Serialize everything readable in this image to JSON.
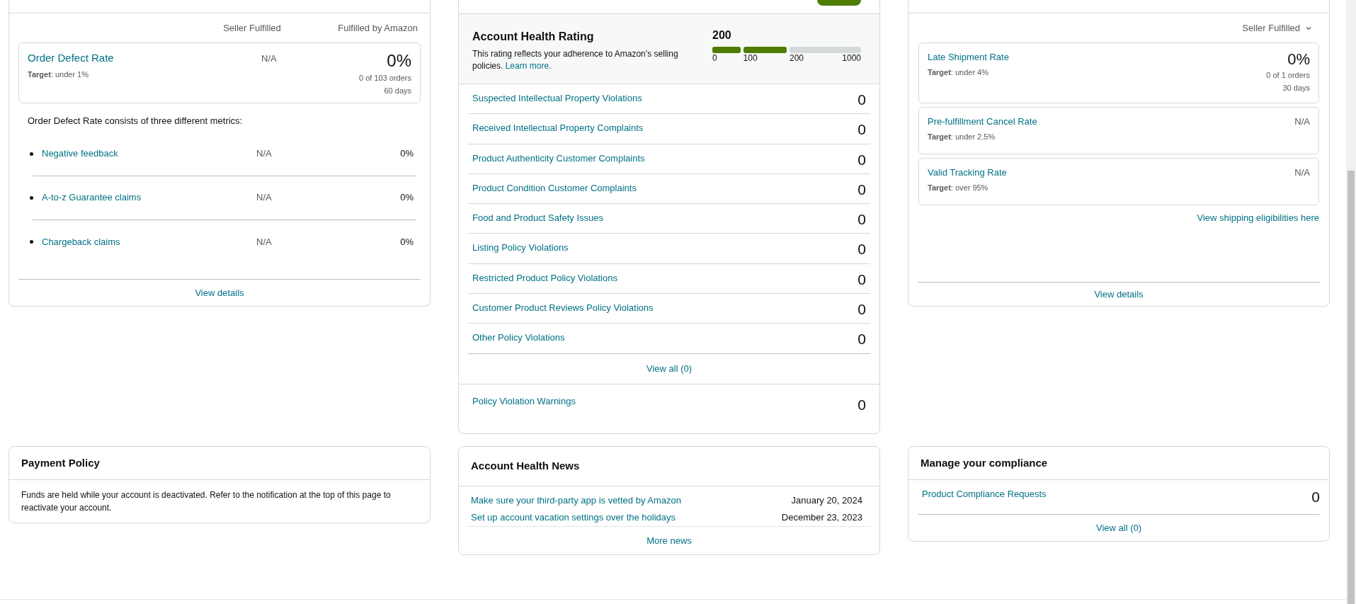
{
  "customer_service": {
    "columns": [
      "Seller Fulfilled",
      "Fulfilled by Amazon"
    ],
    "metric": {
      "name": "Order Defect Rate",
      "target": "**Target**: under 1%",
      "seller": "N/A",
      "fba": "0%",
      "orders": "0 of 103 orders",
      "period": "60 days"
    },
    "description": "Order Defect Rate consists of three different metrics:",
    "sub_metrics": [
      {
        "name": "Negative feedback",
        "seller": "N/A",
        "fba": "0%"
      },
      {
        "name": "A-to-z Guarantee claims",
        "seller": "N/A",
        "fba": "0%"
      },
      {
        "name": "Chargeback claims",
        "seller": "N/A",
        "fba": "0%"
      }
    ],
    "footer_link": "View details"
  },
  "policy_compliance": {
    "rating": {
      "title": "Account Health Rating",
      "description": "This rating reflects your adherence to Amazon’s selling policies.",
      "learn_more": "Learn more.",
      "score": "200",
      "segments": [
        {
          "filled": true
        },
        {
          "filled": true
        },
        {
          "filled": false
        }
      ],
      "ticks": [
        "0",
        "100",
        "200",
        "1000"
      ]
    },
    "violations": [
      {
        "label": "Suspected Intellectual Property Violations",
        "count": "0"
      },
      {
        "label": "Received Intellectual Property Complaints",
        "count": "0"
      },
      {
        "label": "Product Authenticity Customer Complaints",
        "count": "0"
      },
      {
        "label": "Product Condition Customer Complaints",
        "count": "0"
      },
      {
        "label": "Food and Product Safety Issues",
        "count": "0"
      },
      {
        "label": "Listing Policy Violations",
        "count": "0"
      },
      {
        "label": "Restricted Product Policy Violations",
        "count": "0"
      },
      {
        "label": "Customer Product Reviews Policy Violations",
        "count": "0"
      },
      {
        "label": "Other Policy Violations",
        "count": "0"
      }
    ],
    "view_all": "View all (0)",
    "warnings": {
      "label": "Policy Violation Warnings",
      "count": "0"
    }
  },
  "shipping": {
    "filter": "Seller Fulfilled",
    "metrics": [
      {
        "name": "Late Shipment Rate",
        "target": "**Target**: under 4%",
        "value": "0%",
        "orders": "0 of 1 orders",
        "period": "30 days"
      },
      {
        "name": "Pre-fulfillment Cancel Rate",
        "target": "**Target**: under 2.5%",
        "value": "N/A"
      },
      {
        "name": "Valid Tracking Rate",
        "target": "**Target**: over 95%",
        "value": "N/A"
      }
    ],
    "link": "View shipping eligibilities here",
    "footer_link": "View details"
  },
  "payment_policy": {
    "title": "Payment Policy",
    "text": "Funds are held while your account is deactivated. Refer to the notification at the top of this page to reactivate your account."
  },
  "news": {
    "title": "Account Health News",
    "items": [
      {
        "title": "Make sure your third-party app is vetted by Amazon",
        "date": "January 20, 2024"
      },
      {
        "title": "Set up account vacation settings over the holidays",
        "date": "December 23, 2023"
      }
    ],
    "more": "More news"
  },
  "compliance": {
    "title": "Manage your compliance",
    "items": [
      {
        "label": "Product Compliance Requests",
        "count": "0"
      }
    ],
    "view_all": "View all (0)"
  }
}
